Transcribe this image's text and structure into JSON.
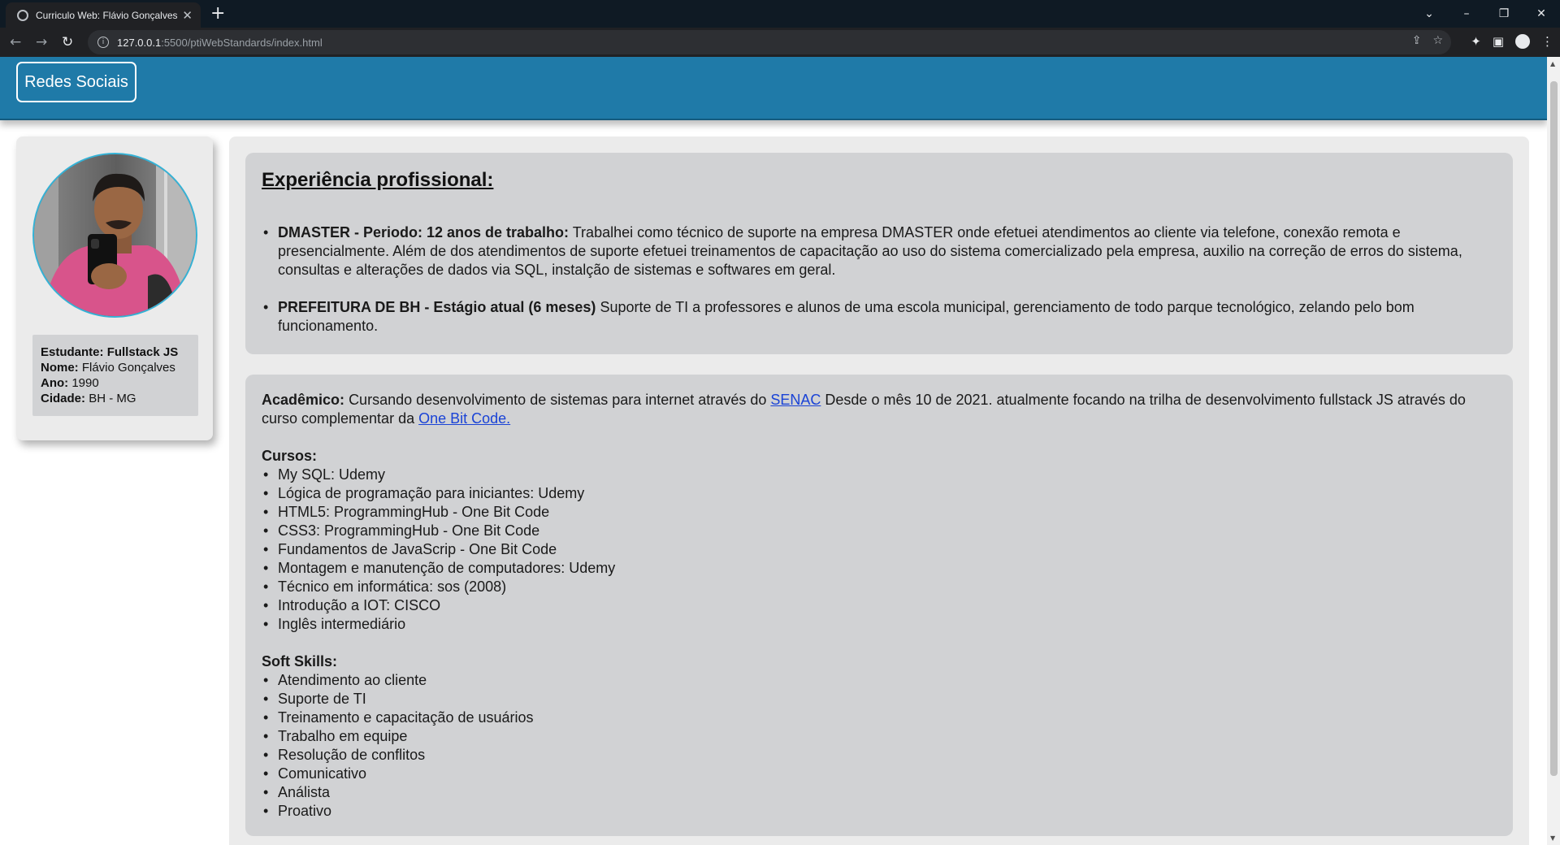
{
  "browser": {
    "tab_title": "Curriculo Web: Flávio Gonçalves",
    "url_host": "127.0.0.1",
    "url_rest": ":5500/ptiWebStandards/index.html"
  },
  "header": {
    "social_button": "Redes Sociais"
  },
  "profile": {
    "student_label": "Estudante:",
    "student_value": "Fullstack JS",
    "name_label": "Nome:",
    "name_value": "Flávio Gonçalves",
    "year_label": "Ano:",
    "year_value": "1990",
    "city_label": "Cidade:",
    "city_value": "BH - MG"
  },
  "experience": {
    "title": "Experiência profissional:",
    "items": [
      {
        "head": "DMASTER - Periodo: 12 anos de trabalho:",
        "text": "Trabalhei como técnico de suporte na empresa DMASTER onde efetuei atendimentos ao cliente via telefone, conexão remota e presencialmente. Além de dos atendimentos de suporte efetuei treinamentos de capacitação ao uso do sistema comercializado pela empresa, auxilio na correção de erros do sistema, consultas e alterações de dados via SQL, instalção de sistemas e softwares em geral."
      },
      {
        "head": "PREFEITURA DE BH - Estágio atual (6 meses)",
        "text": "Suporte de TI a professores e alunos de uma escola municipal, gerenciamento de todo parque tecnológico, zelando pelo bom funcionamento."
      }
    ]
  },
  "academic": {
    "label": "Acadêmico:",
    "text_1": "Cursando desenvolvimento de sistemas para internet através do",
    "link_1": "SENAC",
    "text_2": "Desde o mês 10 de 2021. atualmente focando na trilha de desenvolvimento fullstack JS através do curso complementar da",
    "link_2": "One Bit Code.",
    "courses_title": "Cursos:",
    "courses": [
      "My SQL: Udemy",
      "Lógica de programação para iniciantes: Udemy",
      "HTML5: ProgrammingHub - One Bit Code",
      "CSS3: ProgrammingHub - One Bit Code",
      "Fundamentos de JavaScrip - One Bit Code",
      "Montagem e manutenção de computadores: Udemy",
      "Técnico em informática: sos (2008)",
      "Introdução a IOT: CISCO",
      "Inglês intermediário"
    ],
    "soft_title": "Soft Skills:",
    "soft_skills": [
      "Atendimento ao cliente",
      "Suporte de TI",
      "Treinamento e capacitação de usuários",
      "Trabalho em equipe",
      "Resolução de conflitos",
      "Comunicativo",
      "Análista",
      "Proativo"
    ]
  },
  "colors": {
    "header": "#1f7aa8",
    "panel": "#ebebeb",
    "section": "#d1d2d4",
    "link": "#1a43d6",
    "photo_border": "#34b2d6"
  }
}
